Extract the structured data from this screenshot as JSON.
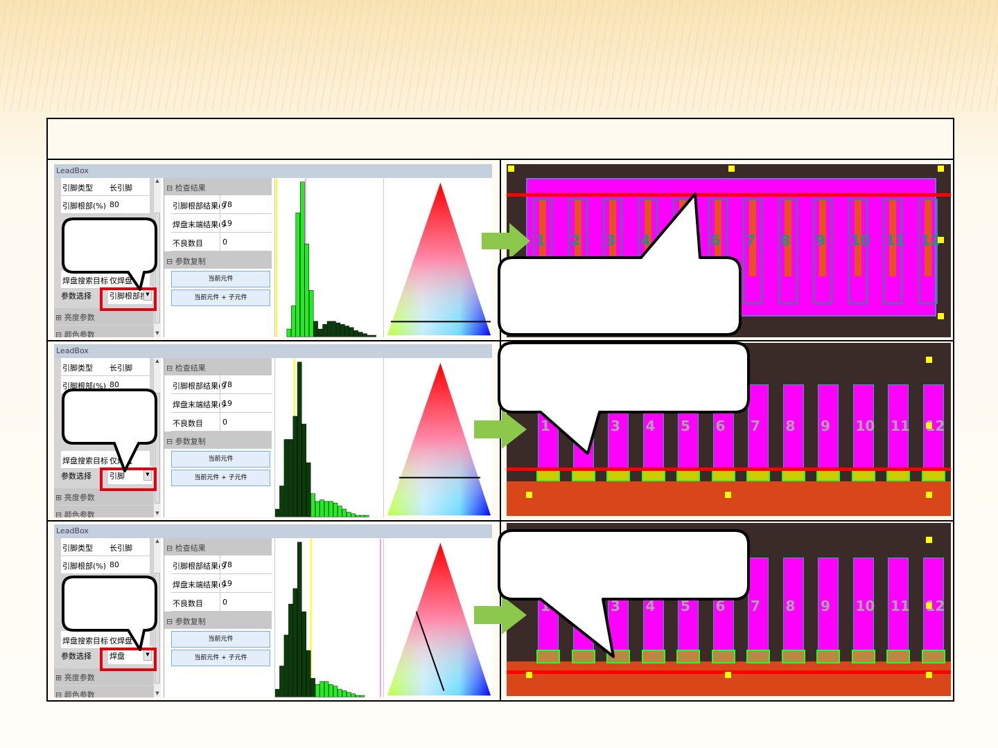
{
  "panels": [
    {
      "title": "LeadBox",
      "grid": {
        "rows": [
          {
            "label": "引脚类型",
            "value": "长引脚"
          },
          {
            "label": "引脚根部(%)",
            "value": "80"
          },
          {
            "label": "焊盘搜索目标",
            "value": "仅焊盘"
          },
          {
            "label": "参数选择",
            "value": "引脚根部搜"
          }
        ],
        "sections": [
          "亮度参数",
          "颜色参数"
        ]
      },
      "results": {
        "section1": "检查结果",
        "rows": [
          {
            "label": "引脚根部结果(9",
            "value": "78"
          },
          {
            "label": "焊盘末端结果(9",
            "value": "19"
          },
          {
            "label": "不良数目",
            "value": "0"
          }
        ],
        "section2": "参数复制",
        "buttons": [
          "当前元件",
          "当前元件 + 子元件"
        ]
      }
    },
    {
      "title": "LeadBox",
      "grid": {
        "rows": [
          {
            "label": "引脚类型",
            "value": "长引脚"
          },
          {
            "label": "引脚根部(%)",
            "value": "80"
          },
          {
            "label": "焊盘搜索目标",
            "value": "仅焊盘"
          },
          {
            "label": "参数选择",
            "value": "引脚"
          }
        ],
        "sections": [
          "亮度参数",
          "颜色参数"
        ]
      },
      "results": {
        "section1": "检查结果",
        "rows": [
          {
            "label": "引脚根部结果(9",
            "value": "78"
          },
          {
            "label": "焊盘末端结果(9",
            "value": "19"
          },
          {
            "label": "不良数目",
            "value": "0"
          }
        ],
        "section2": "参数复制",
        "buttons": [
          "当前元件",
          "当前元件 + 子元件"
        ]
      }
    },
    {
      "title": "LeadBox",
      "grid": {
        "rows": [
          {
            "label": "引脚类型",
            "value": "长引脚"
          },
          {
            "label": "引脚根部(%)",
            "value": "80"
          },
          {
            "label": "焊盘搜索目标",
            "value": "仅焊盘"
          },
          {
            "label": "参数选择",
            "value": "焊盘"
          }
        ],
        "sections": [
          "亮度参数",
          "颜色参数"
        ]
      },
      "results": {
        "section1": "检查结果",
        "rows": [
          {
            "label": "引脚根部结果(9",
            "value": "78"
          },
          {
            "label": "焊盘末端结果(9",
            "value": "19"
          },
          {
            "label": "不良数目",
            "value": "0"
          }
        ],
        "section2": "参数复制",
        "buttons": [
          "当前元件",
          "当前元件 + 子元件"
        ]
      }
    }
  ],
  "pin_numbers": [
    "1",
    "2",
    "3",
    "4",
    "5",
    "6",
    "7",
    "8",
    "9",
    "10",
    "11",
    "12"
  ],
  "histograms": [
    [
      0,
      0,
      0.05,
      0.2,
      0.8,
      1,
      0.6,
      0.3,
      0.1,
      0.05,
      0.08,
      0.1,
      0.1,
      0.09,
      0.08,
      0.07,
      0.06,
      0.04,
      0.03,
      0.02,
      0.01,
      0.01
    ],
    [
      0.05,
      0.2,
      0.5,
      0.5,
      0.65,
      1,
      0.6,
      0.35,
      0.15,
      0.1,
      0.11,
      0.1,
      0.1,
      0.09,
      0.07,
      0.05,
      0.03,
      0.02,
      0.01,
      0.01,
      0.01
    ],
    [
      0.05,
      0.2,
      0.4,
      0.6,
      0.7,
      1,
      0.55,
      0.3,
      0.12,
      0.08,
      0.1,
      0.1,
      0.08,
      0.07,
      0.05,
      0.04,
      0.03,
      0.02,
      0.01,
      0.01
    ]
  ],
  "colors": {
    "accent_red": "#e00010",
    "arrow_green": "#8cc84b",
    "magenta": "#ff00ff"
  }
}
